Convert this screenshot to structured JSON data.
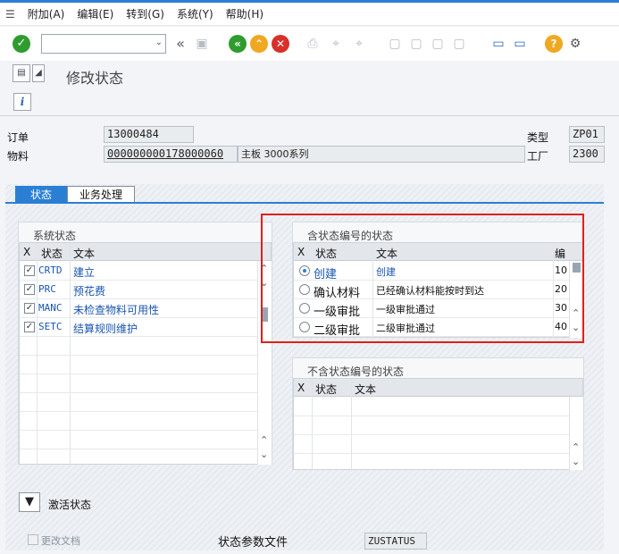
{
  "menu": {
    "items": [
      "附加(A)",
      "编辑(E)",
      "转到(G)",
      "系统(Y)",
      "帮助(H)"
    ]
  },
  "toolbar": {
    "command_value": ""
  },
  "page": {
    "title": "修改状态"
  },
  "header": {
    "order_label": "订单",
    "order_value": "13000484",
    "type_label": "类型",
    "type_value": "ZP01",
    "material_label": "物料",
    "material_value": "000000000178000060",
    "material_desc": "主板 3000系列",
    "plant_label": "工厂",
    "plant_value": "2300"
  },
  "tabs": [
    {
      "label": "状态"
    },
    {
      "label": "业务处理"
    }
  ],
  "system_status": {
    "title": "系统状态",
    "columns": [
      "X",
      "状态",
      "文本"
    ],
    "rows": [
      {
        "code": "CRTD",
        "text": "建立",
        "checked": true
      },
      {
        "code": "PRC",
        "text": "预花费",
        "checked": true
      },
      {
        "code": "MANC",
        "text": "未检查物料可用性",
        "checked": true
      },
      {
        "code": "SETC",
        "text": "结算规则维护",
        "checked": true
      }
    ]
  },
  "status_with_number": {
    "title": "含状态编号的状态",
    "columns": [
      "X",
      "状态",
      "文本",
      "编"
    ],
    "rows": [
      {
        "status": "创建",
        "text": "创建",
        "num": "10",
        "selected": true
      },
      {
        "status": "确认材料",
        "text": "已经确认材料能按时到达",
        "num": "20",
        "selected": false
      },
      {
        "status": "一级审批",
        "text": "一级审批通过",
        "num": "30",
        "selected": false
      },
      {
        "status": "二级审批",
        "text": "二级审批通过",
        "num": "40",
        "selected": false
      }
    ]
  },
  "status_without_number": {
    "title": "不含状态编号的状态",
    "columns": [
      "X",
      "状态",
      "文本"
    ]
  },
  "footer": {
    "activate_label": "激活状态",
    "change_docs_label": "更改文档",
    "profile_label": "状态参数文件",
    "profile_value": "ZUSTATUS"
  },
  "colors": {
    "accent": "#2a7fd4",
    "highlight_box": "#e0201a",
    "ok_green": "#2e9c2e"
  }
}
